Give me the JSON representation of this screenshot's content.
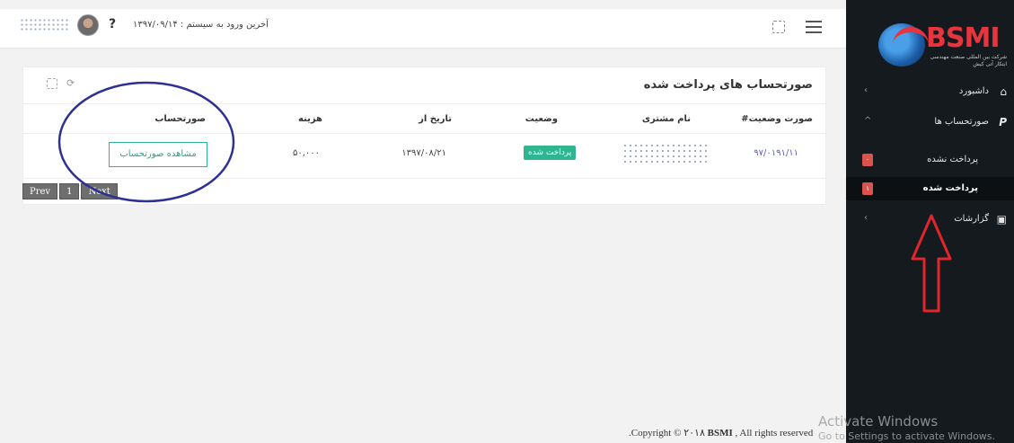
{
  "header": {
    "last_login": "آخرین ورود به سیستم : ۱۳۹۷/۰۹/۱۴",
    "help_label": "?"
  },
  "card": {
    "title": "صورتحساب های پرداخت شده"
  },
  "table": {
    "columns": [
      "صورت وضعیت#",
      "نام مشتری",
      "وضعیت",
      "تاریخ از",
      "هزینه",
      "صورتحساب"
    ],
    "rows": [
      {
        "invoice_no": "۹۷/۰۱۹۱/۱۱",
        "status": "پرداخت شده",
        "date_from": "۱۳۹۷/۰۸/۲۱",
        "cost": "۵۰,۰۰۰",
        "action": "مشاهده صورتحساب"
      }
    ]
  },
  "pagination": {
    "prev": "Prev",
    "page": "1",
    "next": "Next"
  },
  "footer": {
    "copyright_prefix": ".Copyright © ۲۰۱۸ ",
    "copyright_brand": "BSMI",
    "copyright_suffix": " , All rights reserved"
  },
  "sidebar": {
    "logo": "BSMI",
    "logo_sub": "شرکت بین المللی صنعت مهندسی ابتکار آتی کیش",
    "items": [
      {
        "label": "داشبورد",
        "icon": "home-icon"
      },
      {
        "label": "صورتحساب ها",
        "icon": "paypal-icon"
      },
      {
        "label": "گزارشات",
        "icon": "report-icon"
      }
    ],
    "sub_items": [
      {
        "label": "پرداخت نشده",
        "count": "۰"
      },
      {
        "label": "پرداخت شده",
        "count": "۱"
      }
    ]
  },
  "watermark": {
    "line1": "Activate Windows",
    "line2": "Go to Settings to activate Windows."
  },
  "colors": {
    "sidebar_bg": "#151a1e",
    "badge": "#2fb58f",
    "annotation_blue": "#2e3192",
    "annotation_red": "#e0262b"
  }
}
